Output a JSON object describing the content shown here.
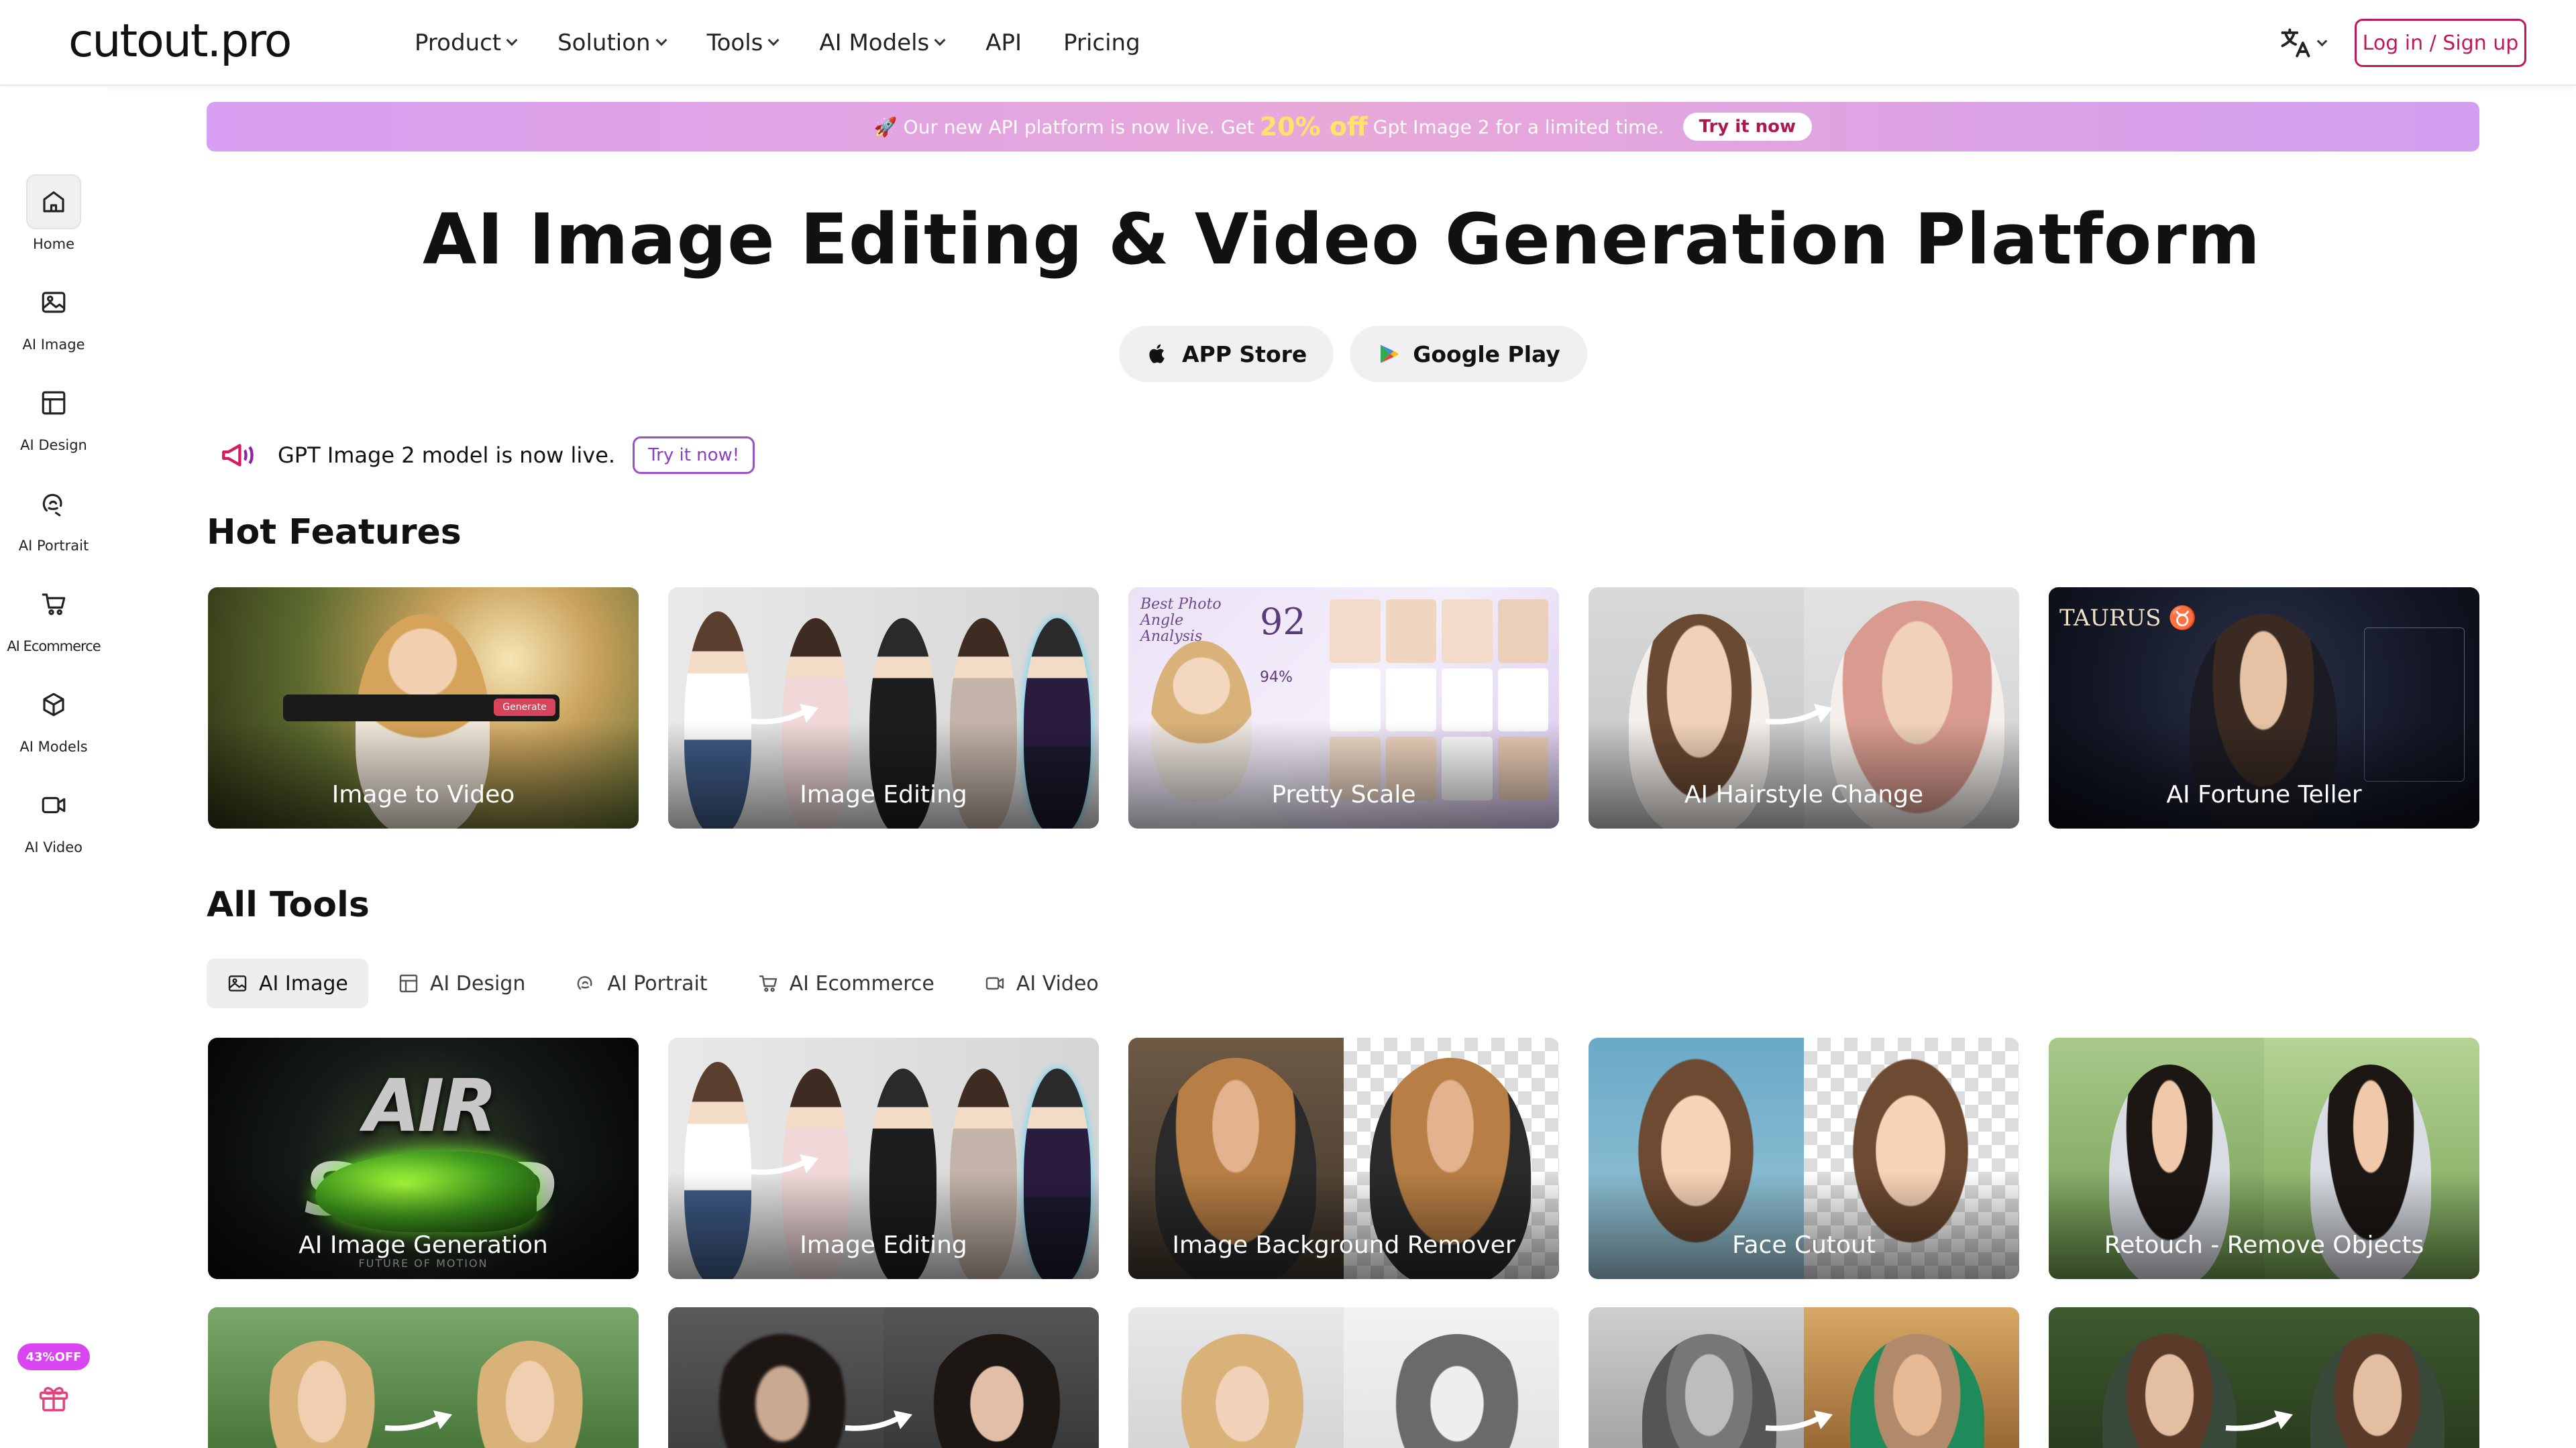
{
  "header": {
    "logo": "cutout.pro",
    "nav": [
      {
        "label": "Product",
        "dropdown": true
      },
      {
        "label": "Solution",
        "dropdown": true
      },
      {
        "label": "Tools",
        "dropdown": true
      },
      {
        "label": "AI Models",
        "dropdown": true
      },
      {
        "label": "API",
        "dropdown": false
      },
      {
        "label": "Pricing",
        "dropdown": false
      }
    ],
    "language_icon": "translate-icon",
    "login_label": "Log in / Sign up"
  },
  "sidebar": {
    "items": [
      {
        "label": "Home",
        "icon": "home-icon",
        "active": true
      },
      {
        "label": "AI Image",
        "icon": "image-icon",
        "active": false
      },
      {
        "label": "AI Design",
        "icon": "layout-icon",
        "active": false
      },
      {
        "label": "AI Portrait",
        "icon": "portrait-icon",
        "active": false
      },
      {
        "label": "AI Ecommerce",
        "icon": "cart-icon",
        "active": false
      },
      {
        "label": "AI Models",
        "icon": "cube-icon",
        "active": false
      },
      {
        "label": "AI Video",
        "icon": "video-icon",
        "active": false
      }
    ],
    "promo_badge": "43%OFF",
    "gift_icon": "gift-icon"
  },
  "banner": {
    "text_before": "🚀 Our new API platform is now live. Get",
    "highlight": "20% off",
    "text_after": "Gpt Image 2 for a limited time.",
    "button": "Try it now"
  },
  "hero": {
    "title": "AI Image Editing & Video Generation Platform",
    "app_store": "APP Store",
    "google_play": "Google Play"
  },
  "announcement": {
    "text": "GPT Image 2 model is now live.",
    "button": "Try it now!"
  },
  "hot_features": {
    "title": "Hot Features",
    "cards": [
      "Image to Video",
      "Image Editing",
      "Pretty Scale",
      "AI Hairstyle Change",
      "AI Fortune Teller"
    ],
    "image_to_video_generate": "Generate",
    "pretty_scale_heading": "Best Photo Angle Analysis",
    "pretty_scale_score": "92",
    "pretty_scale_percent": "94%",
    "fortune_sign": "TAURUS ♉"
  },
  "all_tools": {
    "title": "All Tools",
    "tabs": [
      {
        "label": "AI Image",
        "icon": "image-icon",
        "active": true
      },
      {
        "label": "AI Design",
        "icon": "layout-icon",
        "active": false
      },
      {
        "label": "AI Portrait",
        "icon": "portrait-icon",
        "active": false
      },
      {
        "label": "AI Ecommerce",
        "icon": "cart-icon",
        "active": false
      },
      {
        "label": "AI Video",
        "icon": "video-icon",
        "active": false
      }
    ],
    "cards": [
      "AI Image Generation",
      "Image Editing",
      "Image Background Remover",
      "Face Cutout",
      "Retouch - Remove Objects"
    ],
    "air_speed_text": "AIR SPEED",
    "air_speed_sub": "FUTURE OF MOTION"
  },
  "colors": {
    "brand": "#c2185b",
    "banner_gradient": [
      "#d89ff2",
      "#e8a8d8"
    ],
    "accent_purple": "#8b3fbf"
  }
}
